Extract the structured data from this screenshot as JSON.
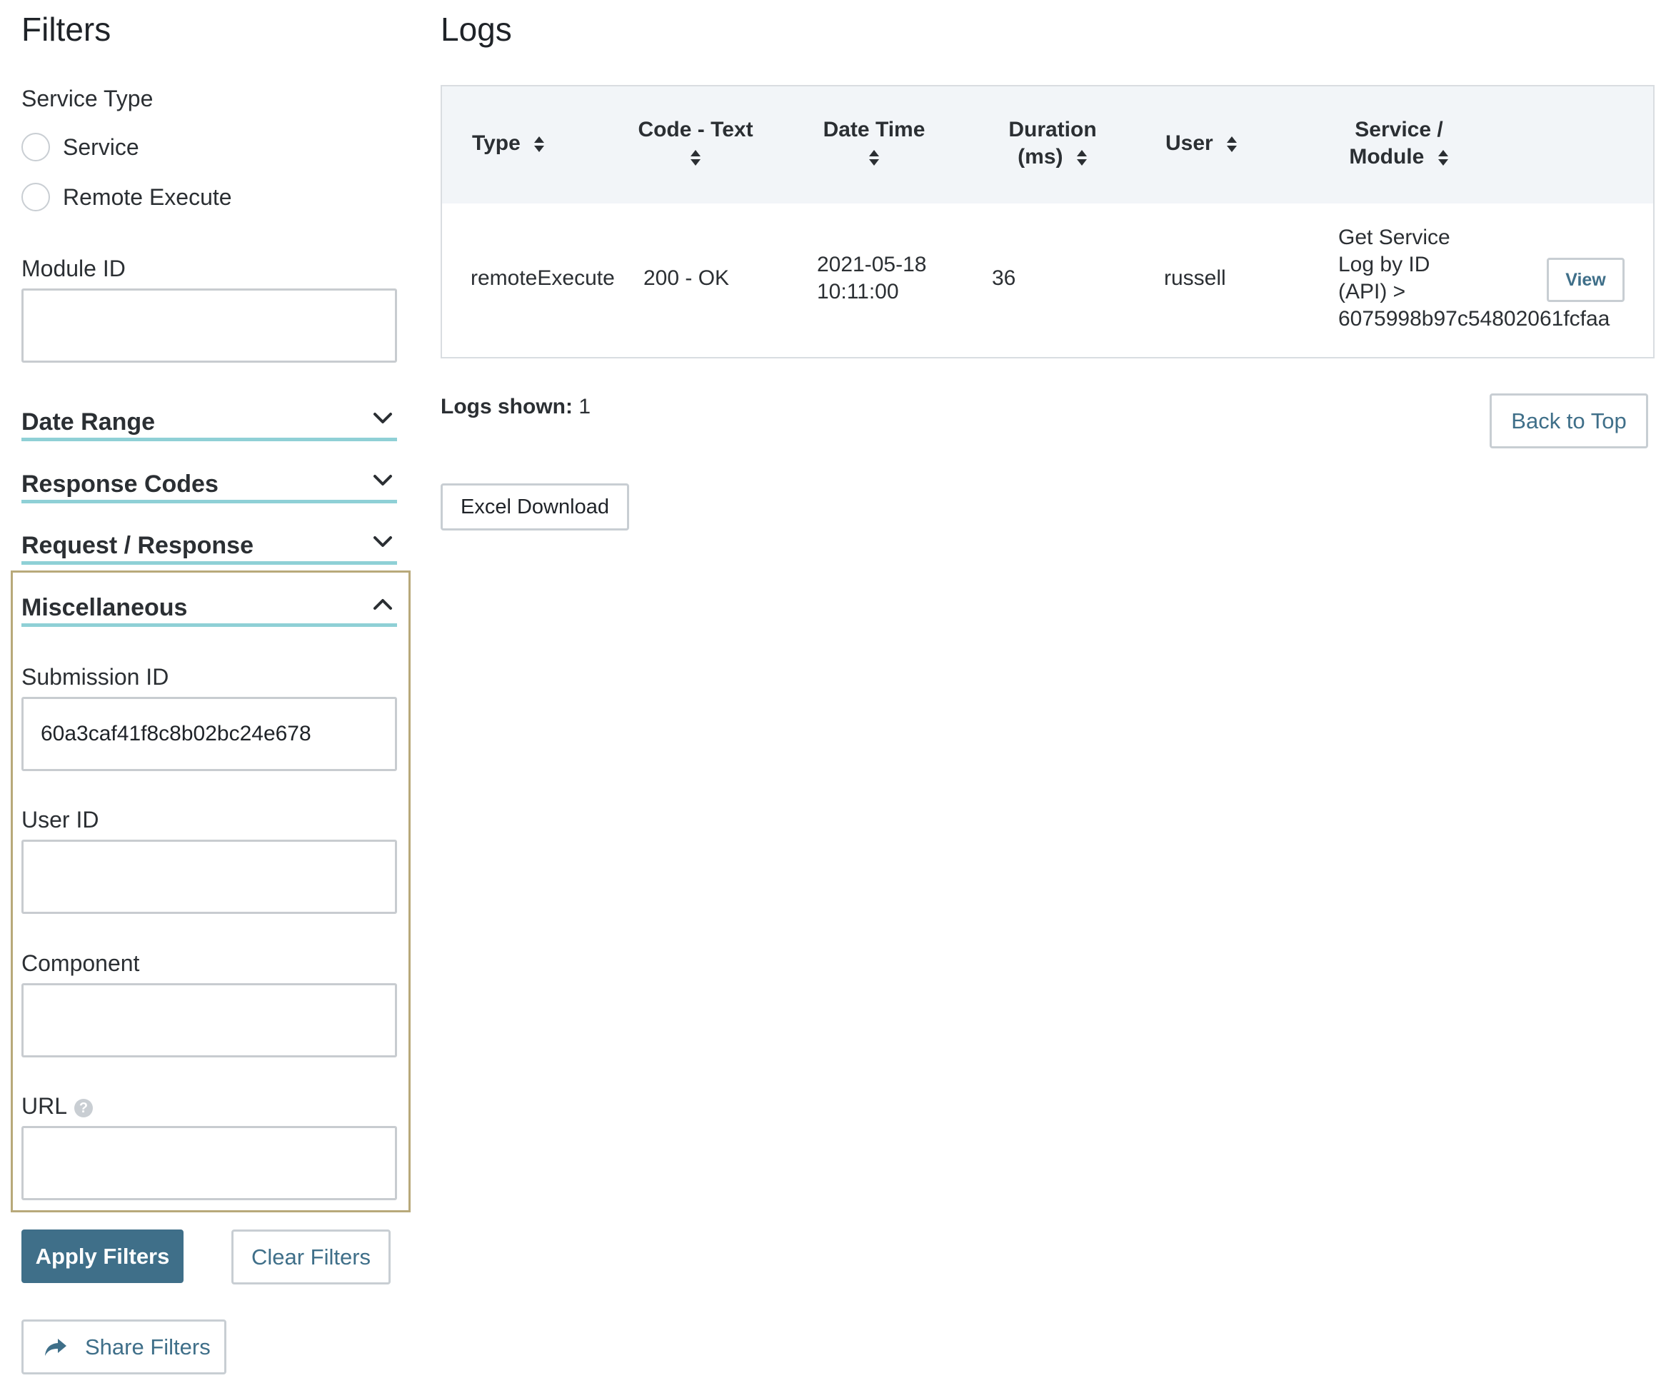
{
  "filters": {
    "title": "Filters",
    "service_type": {
      "label": "Service Type",
      "options": [
        "Service",
        "Remote Execute"
      ]
    },
    "module_id": {
      "label": "Module ID",
      "value": ""
    },
    "sections": {
      "date_range": "Date Range",
      "response_codes": "Response Codes",
      "request_response": "Request / Response",
      "miscellaneous": "Miscellaneous"
    },
    "misc": {
      "submission_id": {
        "label": "Submission ID",
        "value": "60a3caf41f8c8b02bc24e678"
      },
      "user_id": {
        "label": "User ID",
        "value": ""
      },
      "component": {
        "label": "Component",
        "value": ""
      },
      "url": {
        "label": "URL",
        "value": "",
        "help_icon": "question-circle-icon"
      }
    },
    "apply_label": "Apply Filters",
    "clear_label": "Clear Filters",
    "share_label": "Share Filters"
  },
  "logs": {
    "title": "Logs",
    "columns": {
      "type": "Type",
      "code_text": "Code - Text",
      "date_time": "Date Time",
      "duration_1": "Duration",
      "duration_2": "(ms)",
      "user": "User",
      "service_1": "Service /",
      "service_2": "Module"
    },
    "rows": [
      {
        "type": "remoteExecute",
        "code_text": "200 - OK",
        "date": "2021-05-18",
        "time": "10:11:00",
        "duration": "36",
        "user": "russell",
        "service_lines": [
          "Get Service",
          "Log by ID",
          "(API) >",
          "6075998b97c54802061fcfaa"
        ],
        "action_label": "View"
      }
    ],
    "logs_shown_label": "Logs shown:",
    "logs_shown_count": "1",
    "back_to_top_label": "Back to Top",
    "excel_download_label": "Excel Download"
  },
  "colors": {
    "primary": "#3f6f89",
    "accordion_underline": "#8fd0d6",
    "active_section_border": "#b8a97a",
    "table_header_bg": "#f2f5f8"
  }
}
